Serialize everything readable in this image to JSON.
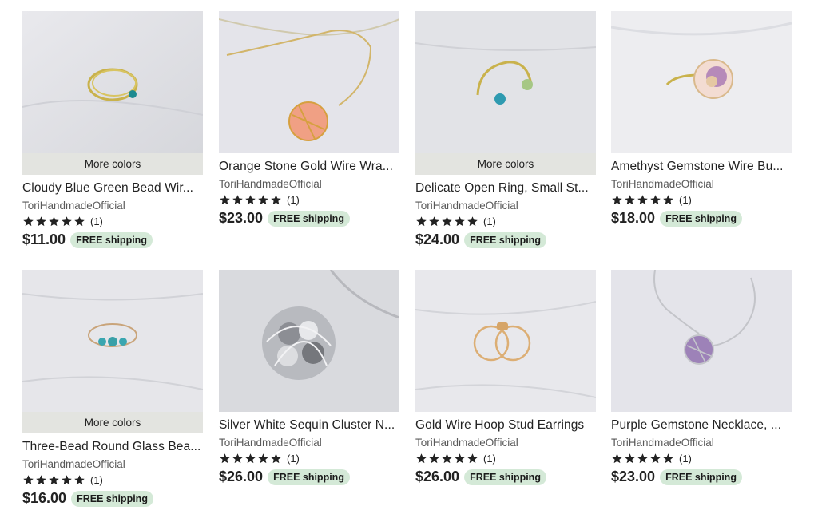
{
  "listings": [
    {
      "title": "Cloudy Blue Green Bead Wir...",
      "shop": "ToriHandmadeOfficial",
      "reviews": "(1)",
      "price": "$11.00",
      "shipping": "FREE shipping",
      "more_colors": "More colors",
      "rating": 5
    },
    {
      "title": "Orange Stone Gold Wire Wra...",
      "shop": "ToriHandmadeOfficial",
      "reviews": "(1)",
      "price": "$23.00",
      "shipping": "FREE shipping",
      "rating": 5
    },
    {
      "title": "Delicate Open Ring, Small St...",
      "shop": "ToriHandmadeOfficial",
      "reviews": "(1)",
      "price": "$24.00",
      "shipping": "FREE shipping",
      "more_colors": "More colors",
      "rating": 5
    },
    {
      "title": "Amethyst Gemstone Wire Bu...",
      "shop": "ToriHandmadeOfficial",
      "reviews": "(1)",
      "price": "$18.00",
      "shipping": "FREE shipping",
      "rating": 5
    },
    {
      "title": "Three-Bead Round Glass Bea...",
      "shop": "ToriHandmadeOfficial",
      "reviews": "(1)",
      "price": "$16.00",
      "shipping": "FREE shipping",
      "more_colors": "More colors",
      "rating": 5
    },
    {
      "title": "Silver White Sequin Cluster N...",
      "shop": "ToriHandmadeOfficial",
      "reviews": "(1)",
      "price": "$26.00",
      "shipping": "FREE shipping",
      "rating": 5
    },
    {
      "title": "Gold Wire Hoop Stud Earrings",
      "shop": "ToriHandmadeOfficial",
      "reviews": "(1)",
      "price": "$26.00",
      "shipping": "FREE shipping",
      "rating": 5
    },
    {
      "title": "Purple Gemstone Necklace, ...",
      "shop": "ToriHandmadeOfficial",
      "reviews": "(1)",
      "price": "$23.00",
      "shipping": "FREE shipping",
      "rating": 5
    }
  ],
  "colors": {
    "star": "#222222",
    "shipping_badge": "#d4e9d7",
    "more_colors_bar": "#e3e4e0"
  }
}
